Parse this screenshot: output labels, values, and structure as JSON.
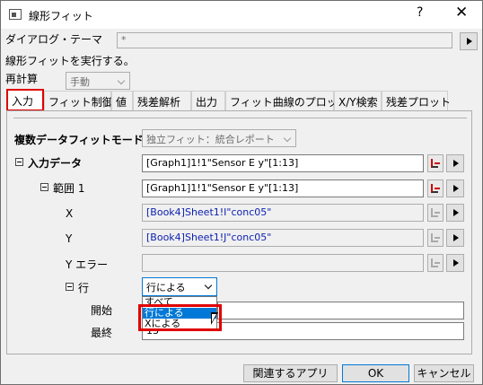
{
  "window": {
    "title": "線形フィット",
    "help_label": "?",
    "close_label": "✕"
  },
  "header": {
    "dialog_theme_label": "ダイアログ・テーマ",
    "dialog_theme_value": "*",
    "description": "線形フィットを実行する。",
    "recalc_label": "再計算",
    "recalc_value": "手動"
  },
  "tabs": [
    {
      "label": "入力"
    },
    {
      "label": "フィット制御"
    },
    {
      "label": "値"
    },
    {
      "label": "残差解析"
    },
    {
      "label": "出力"
    },
    {
      "label": "フィット曲線のプロット"
    },
    {
      "label": "X/Y検索"
    },
    {
      "label": "残差プロット"
    }
  ],
  "input": {
    "multi_fit_label": "複数データフィットモード",
    "multi_fit_value": "独立フィット：統合レポート",
    "input_data_label": "入力データ",
    "input_data_value": "[Graph1]1!1\"Sensor E y\"[1:13]",
    "range_label": "範囲 1",
    "range_value": "[Graph1]1!1\"Sensor E y\"[1:13]",
    "x_label": "X",
    "x_value": "[Book4]Sheet1!I\"conc05\"",
    "y_label": "Y",
    "y_value": "[Book4]Sheet1!J\"conc05\"",
    "yerr_label": "Y エラー",
    "yerr_value": "",
    "row_label": "行",
    "row_value": "行による",
    "row_options": [
      "すべて",
      "行による",
      "Xによる"
    ],
    "start_label": "開始",
    "start_value": "",
    "end_label": "最終",
    "end_value": "13"
  },
  "footer": {
    "related_apps_label": "関連するアプリ",
    "ok_label": "OK",
    "cancel_label": "キャンセル"
  }
}
